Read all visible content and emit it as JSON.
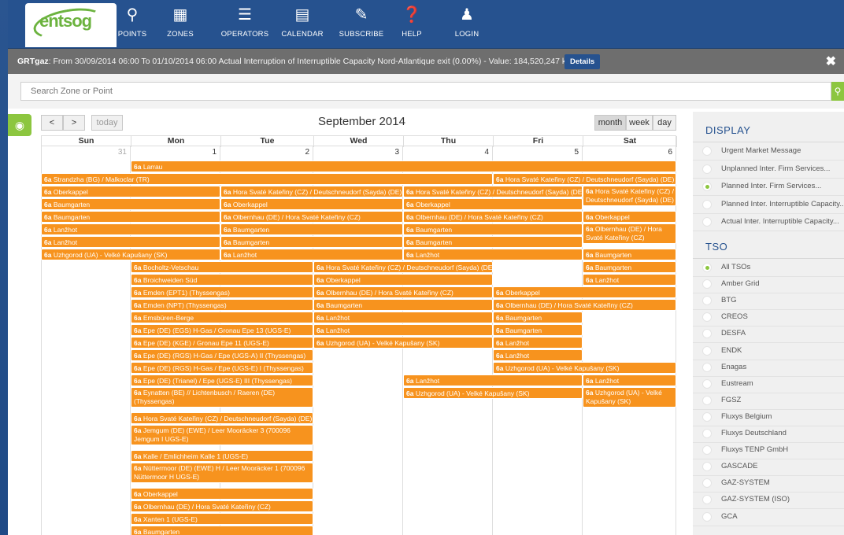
{
  "nav": {
    "logo": "entsog",
    "items": [
      {
        "label": "POINTS",
        "icon": "map-pin-icon"
      },
      {
        "label": "ZONES",
        "icon": "map-icon"
      },
      {
        "label": "OPERATORS",
        "icon": "list-icon"
      },
      {
        "label": "CALENDAR",
        "icon": "calendar-icon"
      },
      {
        "label": "SUBSCRIBE",
        "icon": "pencil-icon"
      },
      {
        "label": "HELP",
        "icon": "help-icon"
      },
      {
        "label": "LOGIN",
        "icon": "user-icon"
      }
    ]
  },
  "alert": {
    "operator": "GRTgaz",
    "message": ": From 30/09/2014 06:00 To 01/10/2014 06:00 Actual Interruption of Interruptible Capacity Nord-Atlantique exit (0.00%) - Value: 184,520,247 kWh/d",
    "details_label": "Details",
    "close": "✖"
  },
  "search": {
    "placeholder": "Search Zone or Point"
  },
  "calendar": {
    "prev": "<",
    "next": ">",
    "today": "today",
    "title": "September 2014",
    "views": [
      "month",
      "week",
      "day"
    ],
    "active_view": "month",
    "weekdays": [
      "Sun",
      "Mon",
      "Tue",
      "Wed",
      "Thu",
      "Fri",
      "Sat"
    ],
    "daynums": [
      "31",
      "1",
      "2",
      "3",
      "4",
      "5",
      "6"
    ],
    "event_prefix": "6a"
  },
  "events": [
    {
      "col": 1,
      "span": 6,
      "row": 0,
      "text": "Larrau"
    },
    {
      "col": 0,
      "span": 5,
      "row": 1,
      "text": "Strandzha (BG) / Malkoclar (TR)"
    },
    {
      "col": 5,
      "span": 2,
      "row": 1,
      "text": "Hora Svaté Kateřiny (CZ) / Deutschneudorf (Sayda) (DE)"
    },
    {
      "col": 0,
      "span": 2,
      "row": 2,
      "text": "Oberkappel"
    },
    {
      "col": 2,
      "span": 2,
      "row": 2,
      "text": "Hora Svaté Kateřiny (CZ) / Deutschneudorf (Sayda) (DE)"
    },
    {
      "col": 4,
      "span": 2,
      "row": 2,
      "text": "Hora Svaté Kateřiny (CZ) / Deutschneudorf (Sayda) (DE)"
    },
    {
      "col": 6,
      "span": 1,
      "row": 2,
      "text": "Hora Svaté Kateřiny (CZ) / Deutschneudorf (Sayda) (DE)",
      "tall": true
    },
    {
      "col": 0,
      "span": 2,
      "row": 3,
      "text": "Baumgarten"
    },
    {
      "col": 2,
      "span": 2,
      "row": 3,
      "text": "Oberkappel"
    },
    {
      "col": 4,
      "span": 2,
      "row": 3,
      "text": "Oberkappel"
    },
    {
      "col": 0,
      "span": 2,
      "row": 4,
      "text": "Baumgarten"
    },
    {
      "col": 2,
      "span": 2,
      "row": 4,
      "text": "Olbernhau (DE) / Hora Svaté Kateřiny (CZ)"
    },
    {
      "col": 4,
      "span": 2,
      "row": 4,
      "text": "Olbernhau (DE) / Hora Svaté Kateřiny (CZ)"
    },
    {
      "col": 0,
      "span": 2,
      "row": 5,
      "text": "Lanžhot"
    },
    {
      "col": 2,
      "span": 2,
      "row": 5,
      "text": "Baumgarten"
    },
    {
      "col": 4,
      "span": 2,
      "row": 5,
      "text": "Baumgarten"
    },
    {
      "col": 0,
      "span": 2,
      "row": 6,
      "text": "Lanžhot"
    },
    {
      "col": 2,
      "span": 2,
      "row": 6,
      "text": "Baumgarten"
    },
    {
      "col": 4,
      "span": 2,
      "row": 6,
      "text": "Baumgarten"
    },
    {
      "col": 0,
      "span": 2,
      "row": 7,
      "text": "Uzhgorod (UA) - Velké Kapušany (SK)"
    },
    {
      "col": 2,
      "span": 2,
      "row": 7,
      "text": "Lanžhot"
    },
    {
      "col": 4,
      "span": 2,
      "row": 7,
      "text": "Lanžhot"
    },
    {
      "col": 1,
      "span": 2,
      "row": 8,
      "text": "Bocholtz-Vetschau"
    },
    {
      "col": 3,
      "span": 2,
      "row": 8,
      "text": "Hora Svaté Kateřiny (CZ) / Deutschneudorf (Sayda) (DE)"
    },
    {
      "col": 1,
      "span": 2,
      "row": 9,
      "text": "Broichweiden Süd"
    },
    {
      "col": 3,
      "span": 2,
      "row": 9,
      "text": "Oberkappel"
    },
    {
      "col": 1,
      "span": 2,
      "row": 10,
      "text": "Emden (EPT1) (Thyssengas)"
    },
    {
      "col": 3,
      "span": 2,
      "row": 10,
      "text": "Olbernhau (DE) / Hora Svaté Kateřiny (CZ)"
    },
    {
      "col": 1,
      "span": 2,
      "row": 11,
      "text": "Emden (NPT) (Thyssengas)"
    },
    {
      "col": 3,
      "span": 2,
      "row": 11,
      "text": "Baumgarten"
    },
    {
      "col": 1,
      "span": 2,
      "row": 12,
      "text": "Emsbüren-Berge"
    },
    {
      "col": 3,
      "span": 2,
      "row": 12,
      "text": "Lanžhot"
    },
    {
      "col": 1,
      "span": 2,
      "row": 13,
      "text": "Epe (DE) (EGS) H-Gas / Gronau Epe 13 (UGS-E)"
    },
    {
      "col": 3,
      "span": 2,
      "row": 13,
      "text": "Lanžhot"
    },
    {
      "col": 1,
      "span": 2,
      "row": 14,
      "text": "Epe (DE) (KGE) / Gronau Epe 11 (UGS-E)"
    },
    {
      "col": 3,
      "span": 2,
      "row": 14,
      "text": "Uzhgorod (UA) - Velké Kapušany (SK)"
    },
    {
      "col": 1,
      "span": 2,
      "row": 15,
      "text": "Epe (DE) (RGS) H-Gas / Epe (UGS-A) II (Thyssengas)"
    },
    {
      "col": 1,
      "span": 2,
      "row": 16,
      "text": "Epe (DE) (RGS) H-Gas / Epe (UGS-E) I (Thyssengas)"
    },
    {
      "col": 1,
      "span": 2,
      "row": 17,
      "text": "Epe (DE) (Trianel) / Epe (UGS-E) III (Thyssengas)"
    },
    {
      "col": 1,
      "span": 2,
      "row": 18,
      "text": "Eynatten (BE) // Lichtenbusch / Raeren (DE) (Thyssengas)",
      "tall": true
    },
    {
      "col": 1,
      "span": 2,
      "row": 20,
      "text": "Hora Svaté Kateřiny (CZ) / Deutschneudorf (Sayda) (DE)"
    },
    {
      "col": 1,
      "span": 2,
      "row": 21,
      "text": "Jemgum (DE) (EWE) / Leer Mooräcker 3 (700096 Jemgum I UGS-E)",
      "tall": true
    },
    {
      "col": 1,
      "span": 2,
      "row": 23,
      "text": "Kalle / Emlichheim Kalle 1 (UGS-E)"
    },
    {
      "col": 1,
      "span": 2,
      "row": 24,
      "text": "Nüttermoor (DE) (EWE) H / Leer Mooräcker 1 (700096 Nüttermoor H UGS-E)",
      "tall": true
    },
    {
      "col": 1,
      "span": 2,
      "row": 26,
      "text": "Oberkappel"
    },
    {
      "col": 1,
      "span": 2,
      "row": 27,
      "text": "Olbernhau (DE) / Hora Svaté Kateřiny (CZ)"
    },
    {
      "col": 1,
      "span": 2,
      "row": 28,
      "text": "Xanten 1 (UGS-E)"
    },
    {
      "col": 1,
      "span": 2,
      "row": 29,
      "text": "Baumgarten"
    },
    {
      "col": 6,
      "span": 1,
      "row": 4,
      "text": "Oberkappel"
    },
    {
      "col": 6,
      "span": 1,
      "row": 5,
      "text": "Olbernhau (DE) / Hora Svaté Kateřiny (CZ)",
      "tall": true
    },
    {
      "col": 6,
      "span": 1,
      "row": 7,
      "text": "Baumgarten"
    },
    {
      "col": 6,
      "span": 1,
      "row": 8,
      "text": "Baumgarten"
    },
    {
      "col": 6,
      "span": 1,
      "row": 9,
      "text": "Lanžhot"
    },
    {
      "col": 5,
      "span": 2,
      "row": 10,
      "text": "Oberkappel"
    },
    {
      "col": 5,
      "span": 2,
      "row": 11,
      "text": "Olbernhau (DE) / Hora Svaté Kateřiny (CZ)"
    },
    {
      "col": 5,
      "span": 1,
      "row": 12,
      "text": "Baumgarten"
    },
    {
      "col": 5,
      "span": 1,
      "row": 13,
      "text": "Baumgarten"
    },
    {
      "col": 5,
      "span": 1,
      "row": 14,
      "text": "Lanžhot"
    },
    {
      "col": 5,
      "span": 1,
      "row": 15,
      "text": "Lanžhot"
    },
    {
      "col": 5,
      "span": 2,
      "row": 16,
      "text": "Uzhgorod (UA) - Velké Kapušany (SK)"
    },
    {
      "col": 4,
      "span": 2,
      "row": 17,
      "text": "Lanžhot"
    },
    {
      "col": 6,
      "span": 1,
      "row": 17,
      "text": "Lanžhot"
    },
    {
      "col": 4,
      "span": 2,
      "row": 18,
      "text": "Uzhgorod (UA) - Velké Kapušany (SK)"
    },
    {
      "col": 6,
      "span": 1,
      "row": 18,
      "text": "Uzhgorod (UA) - Velké Kapušany (SK)",
      "tall": true
    }
  ],
  "sidebar": {
    "display_title": "DISPLAY",
    "display_items": [
      {
        "label": "Urgent Market Message",
        "checked": false
      },
      {
        "label": "Unplanned Inter. Firm Services...",
        "checked": false
      },
      {
        "label": "Planned Inter. Firm Services...",
        "checked": true
      },
      {
        "label": "Planned Inter. Interruptible Capacity...",
        "checked": false
      },
      {
        "label": "Actual Inter. Interruptible Capacity...",
        "checked": false
      }
    ],
    "tso_title": "TSO",
    "tso_items": [
      {
        "label": "All TSOs",
        "checked": true
      },
      {
        "label": "Amber Grid",
        "checked": false
      },
      {
        "label": "BTG",
        "checked": false
      },
      {
        "label": "CREOS",
        "checked": false
      },
      {
        "label": "DESFA",
        "checked": false
      },
      {
        "label": "ENDK",
        "checked": false
      },
      {
        "label": "Enagas",
        "checked": false
      },
      {
        "label": "Eustream",
        "checked": false
      },
      {
        "label": "FGSZ",
        "checked": false
      },
      {
        "label": "Fluxys Belgium",
        "checked": false
      },
      {
        "label": "Fluxys Deutschland",
        "checked": false
      },
      {
        "label": "Fluxys TENP GmbH",
        "checked": false
      },
      {
        "label": "GASCADE",
        "checked": false
      },
      {
        "label": "GAZ-SYSTEM",
        "checked": false
      },
      {
        "label": "GAZ-SYSTEM (ISO)",
        "checked": false
      },
      {
        "label": "GCA",
        "checked": false
      }
    ]
  }
}
